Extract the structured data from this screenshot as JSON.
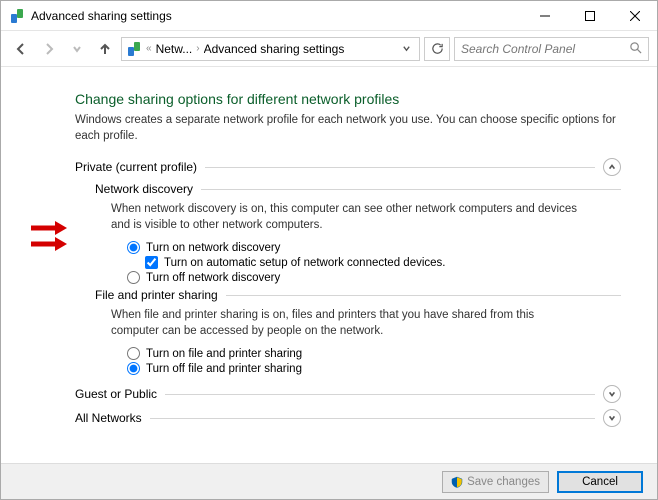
{
  "window": {
    "title": "Advanced sharing settings"
  },
  "nav": {
    "crumb1": "Netw...",
    "crumb2": "Advanced sharing settings",
    "search_placeholder": "Search Control Panel"
  },
  "page": {
    "title": "Change sharing options for different network profiles",
    "intro": "Windows creates a separate network profile for each network you use. You can choose specific options for each profile."
  },
  "sections": {
    "private": {
      "label": "Private (current profile)",
      "network_discovery": {
        "label": "Network discovery",
        "desc": "When network discovery is on, this computer can see other network computers and devices and is visible to other network computers.",
        "opt_on": "Turn on network discovery",
        "opt_auto": "Turn on automatic setup of network connected devices.",
        "opt_off": "Turn off network discovery"
      },
      "file_printer": {
        "label": "File and printer sharing",
        "desc": "When file and printer sharing is on, files and printers that you have shared from this computer can be accessed by people on the network.",
        "opt_on": "Turn on file and printer sharing",
        "opt_off": "Turn off file and printer sharing"
      }
    },
    "guest": {
      "label": "Guest or Public"
    },
    "all": {
      "label": "All Networks"
    }
  },
  "footer": {
    "save": "Save changes",
    "cancel": "Cancel"
  }
}
